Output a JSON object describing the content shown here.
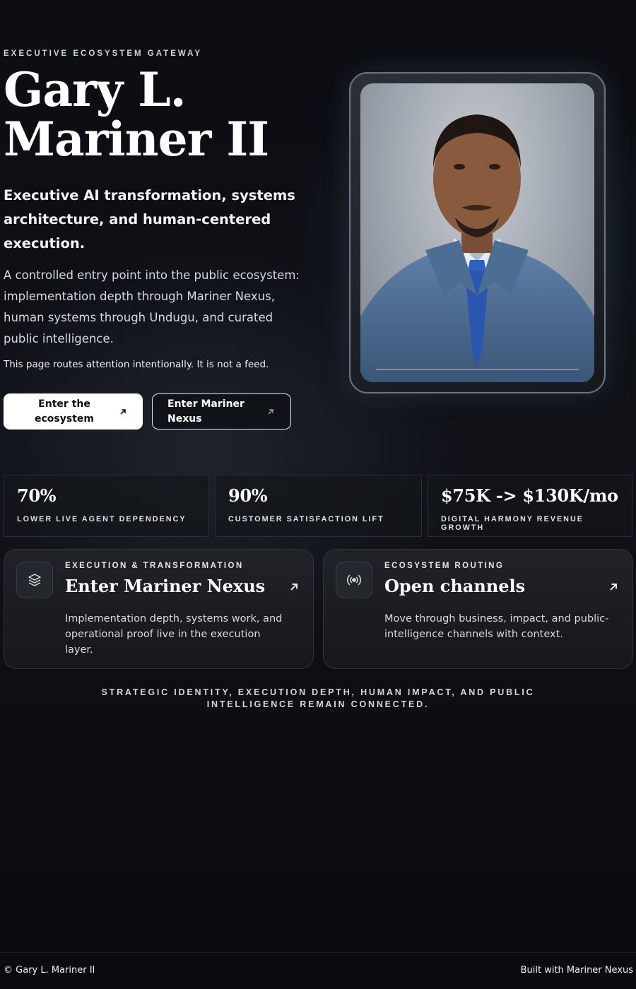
{
  "hero": {
    "eyebrow": "EXECUTIVE ECOSYSTEM GATEWAY",
    "name_line1": "Gary L.",
    "name_line2": "Mariner II",
    "lede": "Executive AI transformation, systems architecture, and human-centered execution.",
    "description": "A controlled entry point into the public ecosystem: implementation depth through Mariner Nexus, human systems through Undugu, and curated public intelligence.",
    "note": "This page routes attention intentionally. It is not a feed.",
    "primary_button": "Enter the ecosystem",
    "secondary_button": "Enter Mariner Nexus"
  },
  "stats": [
    {
      "value": "70%",
      "label": "LOWER LIVE AGENT DEPENDENCY"
    },
    {
      "value": "90%",
      "label": "CUSTOMER SATISFACTION LIFT"
    },
    {
      "value": "$75K -> $130K/mo",
      "label": "DIGITAL HARMONY REVENUE GROWTH"
    }
  ],
  "cards": [
    {
      "icon": "layers-icon",
      "kicker": "EXECUTION & TRANSFORMATION",
      "title": "Enter Mariner Nexus",
      "body": "Implementation depth, systems work, and operational proof live in the execution layer."
    },
    {
      "icon": "broadcast-icon",
      "kicker": "ECOSYSTEM ROUTING",
      "title": "Open channels",
      "body": "Move through business, impact, and public-intelligence channels with context."
    }
  ],
  "tagline": "STRATEGIC IDENTITY, EXECUTION DEPTH, HUMAN IMPACT, AND PUBLIC INTELLIGENCE REMAIN CONNECTED.",
  "footer": {
    "copyright": "© Gary L. Mariner II",
    "credit": "Built with Mariner Nexus"
  },
  "colors": {
    "background": "#0b0c10",
    "text": "#ffffff",
    "primary_button_bg": "#ffffff",
    "card_border": "#30343b"
  }
}
